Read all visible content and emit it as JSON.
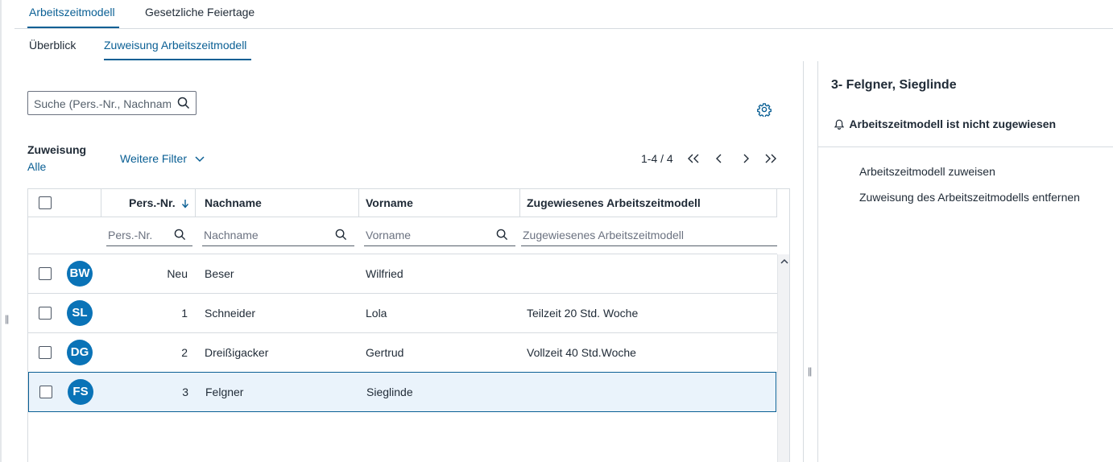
{
  "top_tabs": [
    {
      "label": "Arbeitszeitmodell",
      "active": true
    },
    {
      "label": "Gesetzliche Feiertage",
      "active": false
    }
  ],
  "sub_tabs": [
    {
      "label": "Überblick",
      "active": false
    },
    {
      "label": "Zuweisung Arbeitszeitmodell",
      "active": true
    }
  ],
  "search": {
    "placeholder": "Suche (Pers.-Nr., Nachname, Vorname)",
    "value": ""
  },
  "filters": {
    "zuweisung_label": "Zuweisung",
    "zuweisung_value": "Alle",
    "more_filters_label": "Weitere Filter"
  },
  "pager": {
    "range": "1-4 / 4"
  },
  "table": {
    "columns": [
      "Pers.-Nr.",
      "Nachname",
      "Vorname",
      "Zugewiesenes Arbeitszeitmodell"
    ],
    "filter_placeholders": [
      "Pers.-Nr.",
      "Nachname",
      "Vorname",
      "Zugewiesenes Arbeitszeitmodell"
    ],
    "rows": [
      {
        "initials": "BW",
        "nr": "Neu",
        "nachname": "Beser",
        "vorname": "Wilfried",
        "modell": "",
        "selected": false
      },
      {
        "initials": "SL",
        "nr": "1",
        "nachname": "Schneider",
        "vorname": "Lola",
        "modell": "Teilzeit 20 Std. Woche",
        "selected": false
      },
      {
        "initials": "DG",
        "nr": "2",
        "nachname": "Dreißigacker",
        "vorname": "Gertrud",
        "modell": "Vollzeit 40 Std.Woche",
        "selected": false
      },
      {
        "initials": "FS",
        "nr": "3",
        "nachname": "Felgner",
        "vorname": "Sieglinde",
        "modell": "",
        "selected": true
      }
    ]
  },
  "detail": {
    "title": "3- Felgner, Sieglinde",
    "status": "Arbeitszeitmodell ist nicht zugewiesen",
    "actions": [
      "Arbeitszeitmodell zuweisen",
      "Zuweisung des Arbeitszeitmodells entfernen"
    ]
  },
  "colors": {
    "accent": "#0a5f94",
    "avatar": "#0a73b7",
    "selected_row": "#eaf3fb"
  },
  "icons": [
    "search-icon",
    "gear-icon",
    "chevron-down-icon",
    "sort-down-icon",
    "first-page-icon",
    "prev-page-icon",
    "next-page-icon",
    "last-page-icon",
    "bell-icon",
    "chevron-up-icon"
  ]
}
